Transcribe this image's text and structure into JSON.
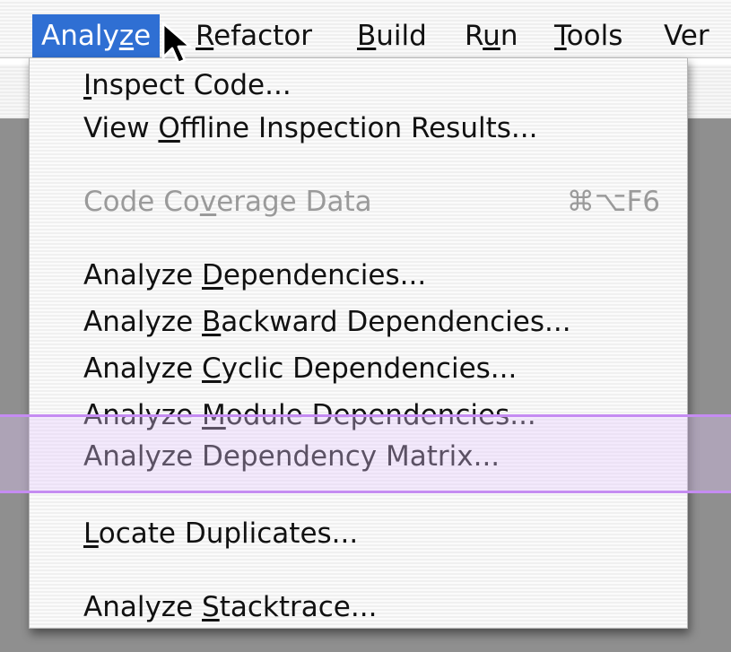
{
  "menubar": {
    "items": [
      {
        "pre": "Analy",
        "mn": "z",
        "post": "e"
      },
      {
        "pre": "",
        "mn": "R",
        "post": "efactor"
      },
      {
        "pre": "",
        "mn": "B",
        "post": "uild"
      },
      {
        "pre": "R",
        "mn": "u",
        "post": "n"
      },
      {
        "pre": "",
        "mn": "T",
        "post": "ools"
      },
      {
        "pre": "Ver",
        "mn": "",
        "post": ""
      }
    ]
  },
  "menu": {
    "items": [
      {
        "pre": "",
        "u": "I",
        "post": "nspect Code..."
      },
      {
        "pre": "View ",
        "u": "O",
        "post": "ffline Inspection Results..."
      },
      {
        "pre": "Code Co",
        "u": "v",
        "post": "erage Data",
        "shortcut": "⌘⌥F6"
      },
      {
        "pre": "Analyze ",
        "u": "D",
        "post": "ependencies..."
      },
      {
        "pre": "Analyze ",
        "u": "B",
        "post": "ackward Dependencies..."
      },
      {
        "pre": "Analyze ",
        "u": "C",
        "post": "yclic Dependencies..."
      },
      {
        "pre": "Analyze ",
        "u": "M",
        "post": "odule Dependencies..."
      },
      {
        "pre": "Analyze Dependency Matrix...",
        "u": "",
        "post": ""
      },
      {
        "pre": "",
        "u": "L",
        "post": "ocate Duplicates..."
      },
      {
        "pre": "Analyze ",
        "u": "S",
        "post": "tacktrace..."
      }
    ]
  },
  "colors": {
    "selection": "#2f6fd3",
    "highlight_border": "#c58cf2",
    "disabled_text": "#9a9a9a"
  },
  "icons": {
    "cursor": "arrow-pointer-icon"
  }
}
